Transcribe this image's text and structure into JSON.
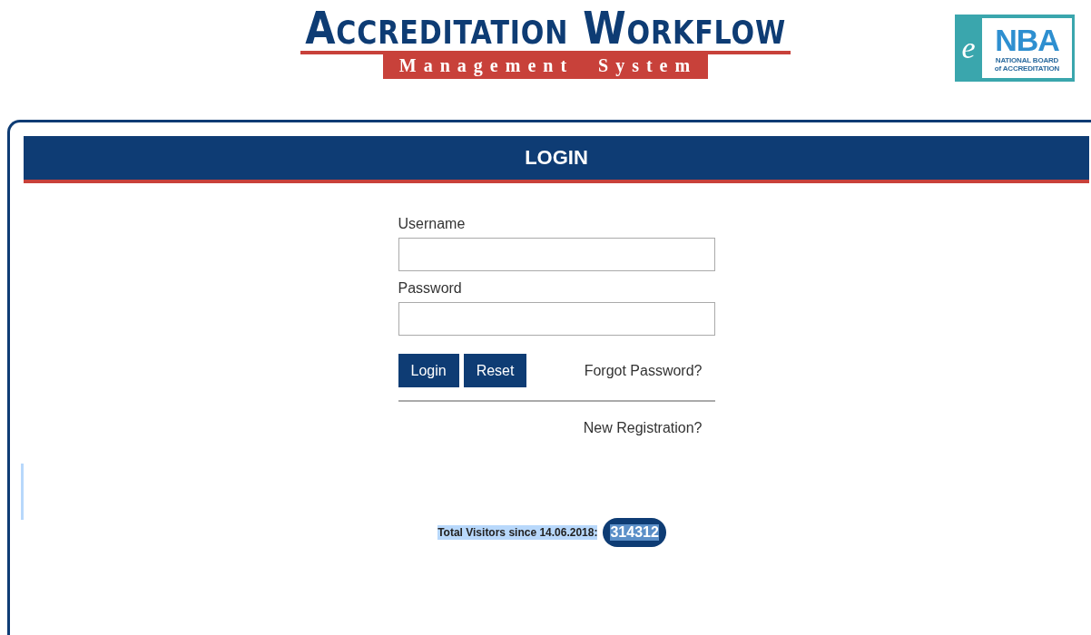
{
  "header": {
    "title": "Accreditation Workflow",
    "subtitle": "Management System",
    "badge": {
      "letter": "e",
      "mark": "NBA",
      "line_1": "NATIONAL BOARD",
      "line_2": "of ACCREDITATION"
    }
  },
  "panel": {
    "title": "LOGIN",
    "fields": [
      {
        "label": "Username"
      },
      {
        "label": "Password"
      }
    ],
    "buttons": [
      "Login",
      "Reset"
    ],
    "forgot_link": "Forgot Password?",
    "register_link": "New Registration?",
    "visitors": {
      "label": "Total Visitors since 14.06.2018:",
      "count": "314312",
      "selected": true
    }
  }
}
